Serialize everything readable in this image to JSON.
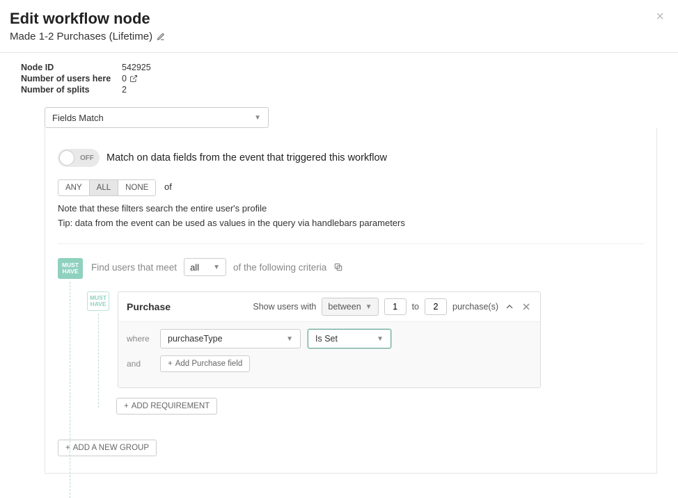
{
  "header": {
    "title": "Edit workflow node",
    "subtitle": "Made 1-2 Purchases (Lifetime)"
  },
  "meta": {
    "node_id_label": "Node ID",
    "node_id_value": "542925",
    "users_label": "Number of users here",
    "users_value": "0",
    "splits_label": "Number of splits",
    "splits_value": "2"
  },
  "panel": {
    "type_select": "Fields Match",
    "toggle_text": "OFF",
    "toggle_label": "Match on data fields from the event that triggered this workflow",
    "logic": {
      "any": "ANY",
      "all": "ALL",
      "none": "NONE",
      "of": "of"
    },
    "note1": "Note that these filters search the entire user's profile",
    "note2": "Tip: data from the event can be used as values in the query via handlebars parameters"
  },
  "group": {
    "must": "MUST",
    "have": "HAVE",
    "find_pre": "Find users that meet",
    "find_sel": "all",
    "find_post": "of the following criteria"
  },
  "purchase": {
    "title": "Purchase",
    "show_label": "Show users with",
    "range": "between",
    "from": "1",
    "to_word": "to",
    "to": "2",
    "unit": "purchase(s)",
    "where": "where",
    "field": "purchaseType",
    "op": "Is Set",
    "and": "and",
    "add_field": "Add Purchase field"
  },
  "buttons": {
    "add_req": "ADD REQUIREMENT",
    "add_group": "ADD A NEW GROUP"
  }
}
